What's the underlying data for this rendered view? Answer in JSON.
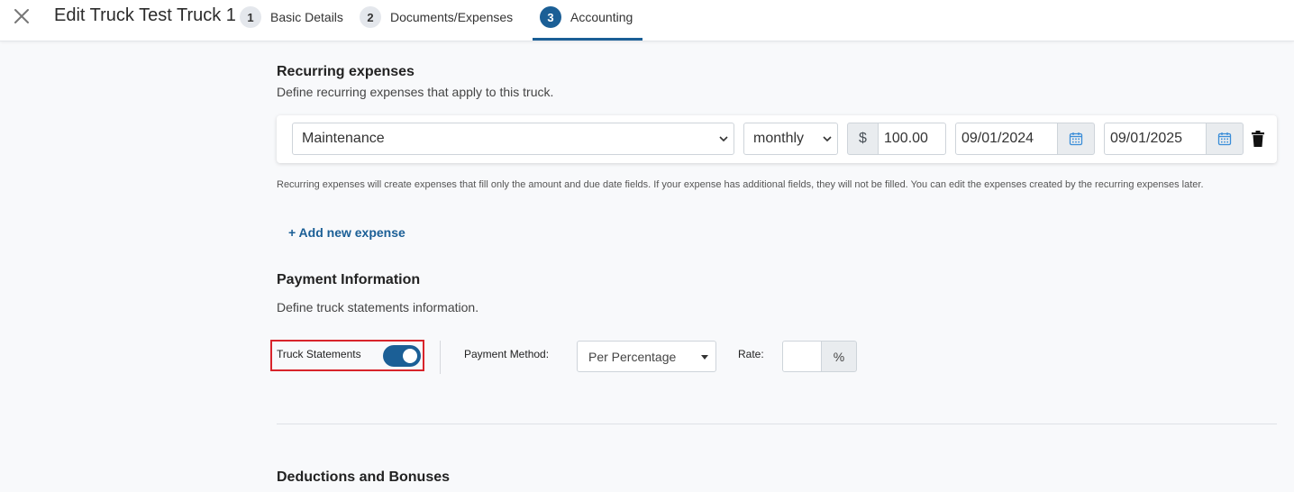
{
  "header": {
    "title": "Edit Truck Test Truck 1",
    "steps": [
      {
        "num": "1",
        "label": "Basic Details"
      },
      {
        "num": "2",
        "label": "Documents/Expenses"
      },
      {
        "num": "3",
        "label": "Accounting"
      }
    ],
    "active_step": "Accounting"
  },
  "recurring": {
    "title": "Recurring expenses",
    "subtitle": "Define recurring expenses that apply to this truck.",
    "expense": {
      "type": "Maintenance",
      "frequency": "monthly",
      "currency": "$",
      "amount": "100.00",
      "start_date": "09/01/2024",
      "end_date": "09/01/2025"
    },
    "note": "Recurring expenses will create expenses that fill only the amount and due date fields. If your expense has additional fields, they will not be filled. You can edit the expenses created by the recurring expenses later.",
    "add_label": "+ Add new expense"
  },
  "payment": {
    "title": "Payment Information",
    "subtitle": "Define truck statements information.",
    "truck_statements_label": "Truck Statements",
    "truck_statements_on": true,
    "method_label": "Payment Method:",
    "method_value": "Per Percentage",
    "rate_label": "Rate:",
    "rate_value": "",
    "rate_unit": "%"
  },
  "deductions": {
    "title": "Deductions and Bonuses"
  },
  "colors": {
    "accent": "#1b5f96",
    "highlight": "#d8242b"
  }
}
